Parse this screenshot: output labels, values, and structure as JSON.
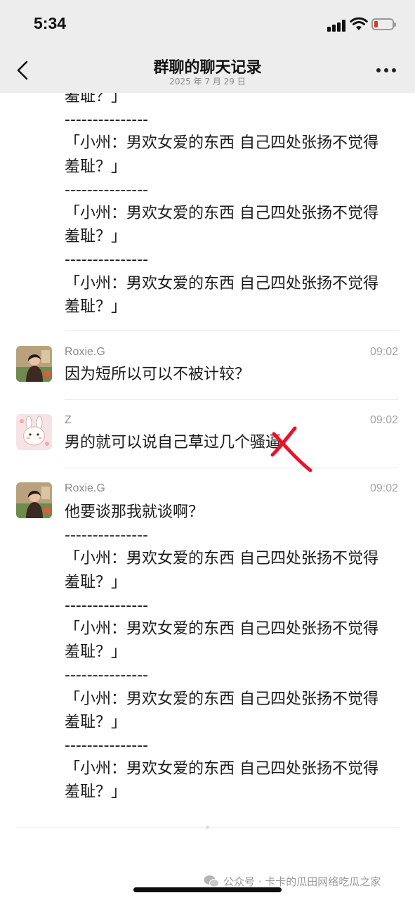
{
  "status": {
    "time": "5:34"
  },
  "nav": {
    "title": "群聊的聊天记录",
    "subtitle": "2025 年 7 月 29 日"
  },
  "messages": [
    {
      "lines": [
        "羞耻？」",
        "---------------",
        "「小州：男欢女爱的东西 自己四处张扬不觉得",
        "羞耻？」",
        "---------------",
        "「小州：男欢女爱的东西 自己四处张扬不觉得",
        "羞耻？」",
        "---------------",
        "「小州：男欢女爱的东西 自己四处张扬不觉得",
        "羞耻？」"
      ]
    },
    {
      "sender": "Roxie.G",
      "time": "09:02",
      "lines": [
        "因为短所以可以不被计较？"
      ]
    },
    {
      "sender": "Z",
      "time": "09:02",
      "lines": [
        "男的就可以说自己草过几个骚逼"
      ]
    },
    {
      "sender": "Roxie.G",
      "time": "09:02",
      "lines": [
        "他要谈那我就谈啊？",
        "---------------",
        "「小州：男欢女爱的东西 自己四处张扬不觉得",
        "羞耻？」",
        "---------------",
        "「小州：男欢女爱的东西 自己四处张扬不觉得",
        "羞耻？」",
        "---------------",
        "「小州：男欢女爱的东西 自己四处张扬不觉得",
        "羞耻？」",
        "---------------",
        "「小州：男欢女爱的东西 自己四处张扬不觉得",
        "羞耻？」"
      ]
    }
  ],
  "footer": {
    "watermark": "公众号 · 卡卡的瓜田网络吃瓜之家"
  },
  "colors": {
    "header_bg": "#ededed",
    "battery_low": "#e0332b",
    "mark_red": "#e8142a"
  },
  "icons": [
    "back-arrow-icon",
    "more-icon",
    "signal-icon",
    "wifi-icon",
    "battery-icon",
    "wechat-icon"
  ]
}
